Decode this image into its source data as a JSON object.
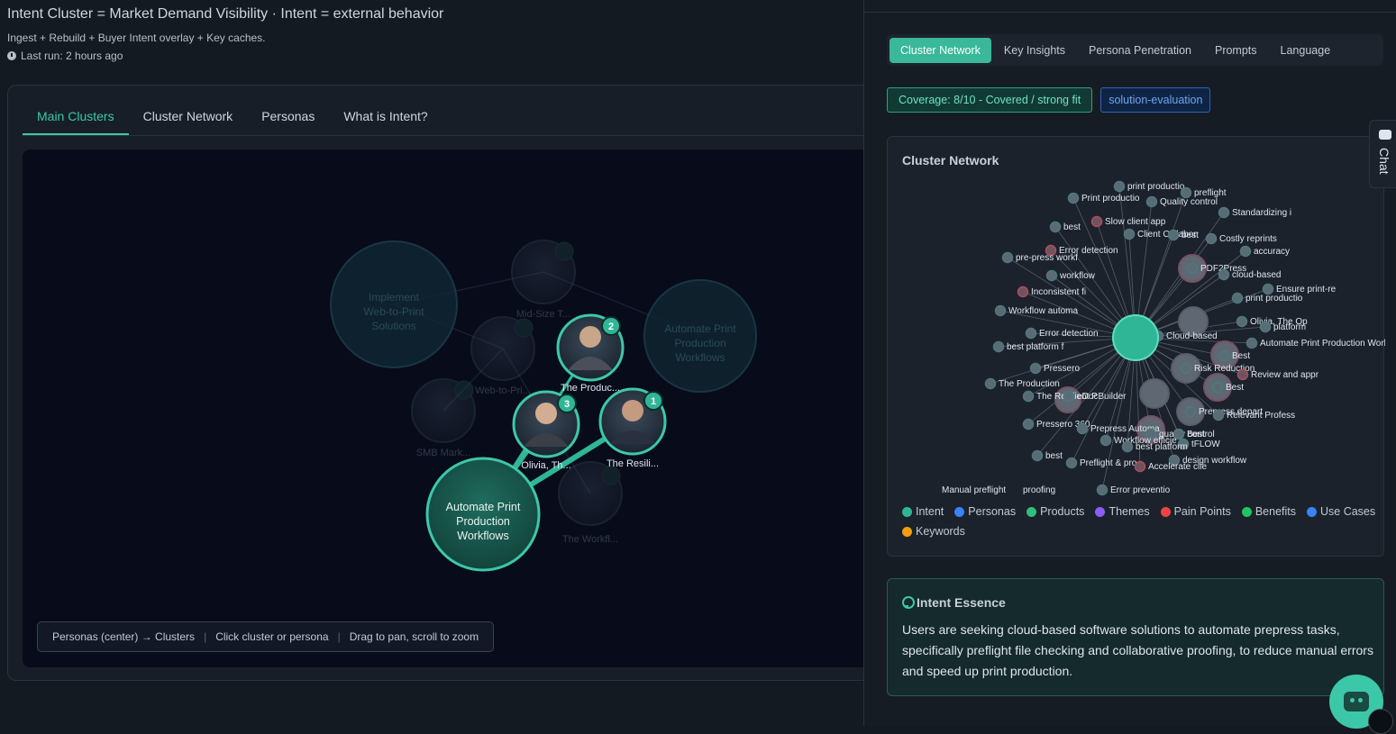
{
  "header": {
    "title": "Intent Cluster = Market Demand Visibility · Intent = external behavior",
    "subtitle": "Ingest + Rebuild + Buyer Intent overlay + Key caches.",
    "last_run": "Last run: 2 hours ago"
  },
  "main_tabs": [
    "Main Clusters",
    "Cluster Network",
    "Personas",
    "What is Intent?"
  ],
  "viz": {
    "faded_clusters": [
      "Implement Web-to-Print Solutions",
      "Automate Print Production Workflows"
    ],
    "faded_personas": [
      "Mid-Size T...",
      "Web-to-Pri...",
      "SMB Mark...",
      "The Workfl..."
    ],
    "active_cluster": "Automate Print Production Workflows",
    "active_personas": [
      {
        "label": "The Produc...",
        "rank": "2"
      },
      {
        "label": "Olivia, Th...",
        "rank": "3"
      },
      {
        "label": "The Resili...",
        "rank": "1"
      }
    ],
    "hint": [
      "Personas (center) → Clusters",
      "Click cluster or persona",
      "Drag to pan, scroll to zoom"
    ]
  },
  "panel": {
    "tabs": [
      "Cluster Network",
      "Key Insights",
      "Persona Penetration",
      "Prompts",
      "Language"
    ],
    "coverage": "Coverage: 8/10 - Covered / strong fit",
    "tag": "solution-evaluation",
    "network_title": "Cluster Network",
    "network_labels": [
      "print productio",
      "preflight",
      "Print productio",
      "Quality control",
      "Standardizing i",
      "best",
      "Slow client app",
      "Client Collabor",
      "best",
      "Costly reprints",
      "Error detection",
      "accuracy",
      "pre-press workf",
      "PDF2Press",
      "workflow",
      "cloud-based",
      "Ensure print-re",
      "Inconsistent fi",
      "print productio",
      "Workflow automa",
      "Olivia, The Op",
      "platform",
      "Error detection",
      "Cloud-based",
      "Automate Print Production Workflows",
      "best platform f",
      "Best",
      "Pressero",
      "Risk Reduction",
      "The Production",
      "Best",
      "Review and appr",
      "The Resilient P",
      "eDocBuilder",
      "Prepress depart",
      "Relevant Profess",
      "Pressero 360",
      "Prepress Automa",
      "quality control",
      "Best",
      "tFLOW",
      "Workflow efficie",
      "best platform",
      "best",
      "Preflight & pro",
      "design workflow",
      "Accelerate clie",
      "Error preventio",
      "Manual preflight",
      "proofing"
    ],
    "legend": [
      {
        "label": "Intent",
        "color": "#3cc8a8"
      },
      {
        "label": "Personas",
        "color": "#3b82f6"
      },
      {
        "label": "Products",
        "color": "#2fbf7a"
      },
      {
        "label": "Themes",
        "color": "#8b5cf6"
      },
      {
        "label": "Pain Points",
        "color": "#ef4444"
      },
      {
        "label": "Benefits",
        "color": "#22c55e"
      },
      {
        "label": "Use Cases",
        "color": "#3b82f6"
      },
      {
        "label": "Keywords",
        "color": "#f59e0b"
      }
    ],
    "essence_title": "Intent Essence",
    "essence_text": "Users are seeking cloud-based software solutions to automate prepress tasks, specifically preflight file checking and collaborative proofing, to reduce manual errors and speed up print production."
  },
  "chat_label": "Chat"
}
